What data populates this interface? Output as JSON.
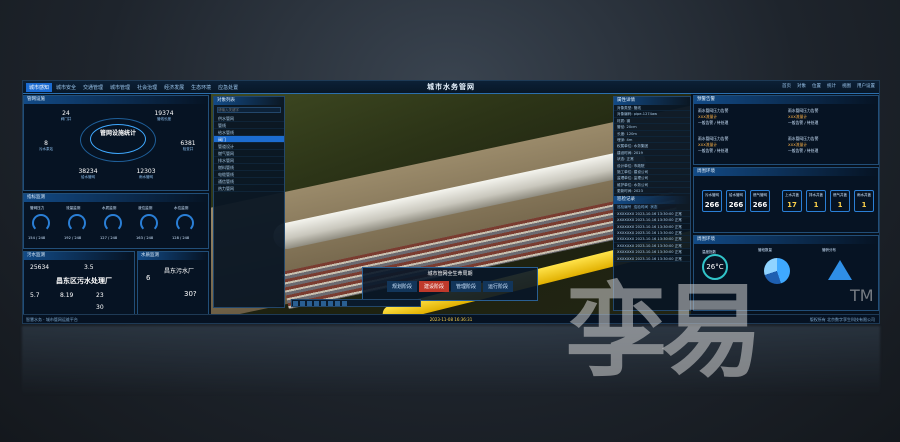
{
  "app": {
    "title": "城市水务管网"
  },
  "nav": {
    "tabs": [
      "城市感知",
      "城市安全",
      "交通管理",
      "城市管理",
      "社会治理",
      "经济发展",
      "生态环境",
      "应急处置"
    ]
  },
  "top_right": {
    "items": [
      "首页",
      "对象",
      "位置",
      "统计",
      "视图",
      "用户设置"
    ]
  },
  "left": {
    "overview_title": "管网设施",
    "center_label": "管网设施统计",
    "stats": [
      {
        "value": "24",
        "label": "阀门井"
      },
      {
        "value": "19374",
        "label": "管线长度"
      },
      {
        "value": "8",
        "label": "污水泵站"
      },
      {
        "value": "6381",
        "label": "检查井"
      },
      {
        "value": "38234",
        "label": "给水管网"
      },
      {
        "value": "12303",
        "label": "雨水管网"
      }
    ],
    "gauge_title": "指标监测",
    "gauges": [
      {
        "label": "管网压力",
        "value": "154 / 248"
      },
      {
        "label": "流量监测",
        "value": "192 / 248"
      },
      {
        "label": "水质监测",
        "value": "127 / 248"
      },
      {
        "label": "液位监测",
        "value": "163 / 248"
      },
      {
        "label": "水位监测",
        "value": "128 / 248"
      }
    ],
    "plant_title": "污水监测",
    "plant_name": "昌东区污水处理厂",
    "plant_values": [
      "25634",
      "3.5",
      "5.7",
      "8.19",
      "23",
      "30"
    ],
    "side_title": "水质监测",
    "side_name": "昌东污水厂",
    "side_values": [
      "6",
      "30?"
    ]
  },
  "tree": {
    "title": "对象列表",
    "search_placeholder": "请输入关键字",
    "rows": [
      "供水管网",
      "管线",
      "给水管线",
      "阀门",
      "管道设计",
      "燃气管网",
      "排水管网",
      "燃料管线",
      "电缆管线",
      "通信管线",
      "热力管网"
    ],
    "selected_index": 3
  },
  "attributes": {
    "title": "属性详情",
    "rows": [
      "对象类型: 管线",
      "对象编码: pipe-1274aw",
      "材质: 钢",
      "管径: 20cm",
      "长度: 120m",
      "埋深: 4m",
      "权属单位: 水务集团",
      "建设时间: 2019",
      "状态: 正常",
      "设计单位: 市政院",
      "施工单位: 建设公司",
      "监理单位: 监理公司",
      "维护单位: 水务公司",
      "更新时间: 2023"
    ],
    "log_title": "巡检记录",
    "log_header": [
      "巡检编号",
      "巡检时间",
      "状态"
    ],
    "log_rows": [
      [
        "XXXXXXX",
        "2023-10-16 13:30:00",
        "正常"
      ],
      [
        "XXXXXXX",
        "2023-10-16 13:30:00",
        "正常"
      ],
      [
        "XXXXXXX",
        "2023-10-16 13:30:00",
        "正常"
      ],
      [
        "XXXXXXX",
        "2023-10-16 13:30:00",
        "正常"
      ],
      [
        "XXXXXXX",
        "2023-10-16 13:30:00",
        "正常"
      ],
      [
        "XXXXXXX",
        "2023-10-16 13:30:00",
        "正常"
      ],
      [
        "XXXXXXX",
        "2023-10-16 13:30:00",
        "正常"
      ],
      [
        "XXXXXXX",
        "2023-10-16 13:30:00",
        "正常"
      ]
    ]
  },
  "lifecycle": {
    "title": "城市管网全生命周期",
    "stages": [
      "规划阶段",
      "建设阶段",
      "管理阶段",
      "运行阶段"
    ],
    "active_index": 1
  },
  "right": {
    "alert_title": "预警告警",
    "alerts": [
      {
        "name": "雨水管网压力告警",
        "code": "XXX流量计",
        "status": "一般告警 / 待处理"
      },
      {
        "name": "雨水管网压力告警",
        "code": "XXX流量计",
        "status": "一般告警 / 待处理"
      },
      {
        "name": "雨水管网压力告警",
        "code": "XXX流量计",
        "status": "一般告警 / 待处理"
      },
      {
        "name": "雨水管网压力告警",
        "code": "XXX流量计",
        "status": "一般告警 / 待处理"
      }
    ],
    "env_title": "周围环境",
    "env_cards": [
      {
        "label": "污水管网",
        "value": "266"
      },
      {
        "label": "给水管网",
        "value": "266"
      },
      {
        "label": "燃气管网",
        "value": "266"
      },
      {
        "label": "上水井盖",
        "value": "17"
      },
      {
        "label": "排水井盖",
        "value": "1"
      },
      {
        "label": "燃气井盖",
        "value": "1"
      },
      {
        "label": "雨水井盖",
        "value": "1"
      }
    ],
    "weather_title": "周围环境",
    "temperature": "26°C",
    "weather_label": "温度指数",
    "chart_labels": [
      "管段数量",
      "管龄分布"
    ]
  },
  "bottom": {
    "left_text": "智慧水务 · 城市管网运维平台",
    "time": "2023-11-08 16:36:31",
    "right_text": "版权所有 北京数字孪生科技有限公司"
  },
  "watermark": {
    "text": "孪易",
    "tm": "TM"
  }
}
